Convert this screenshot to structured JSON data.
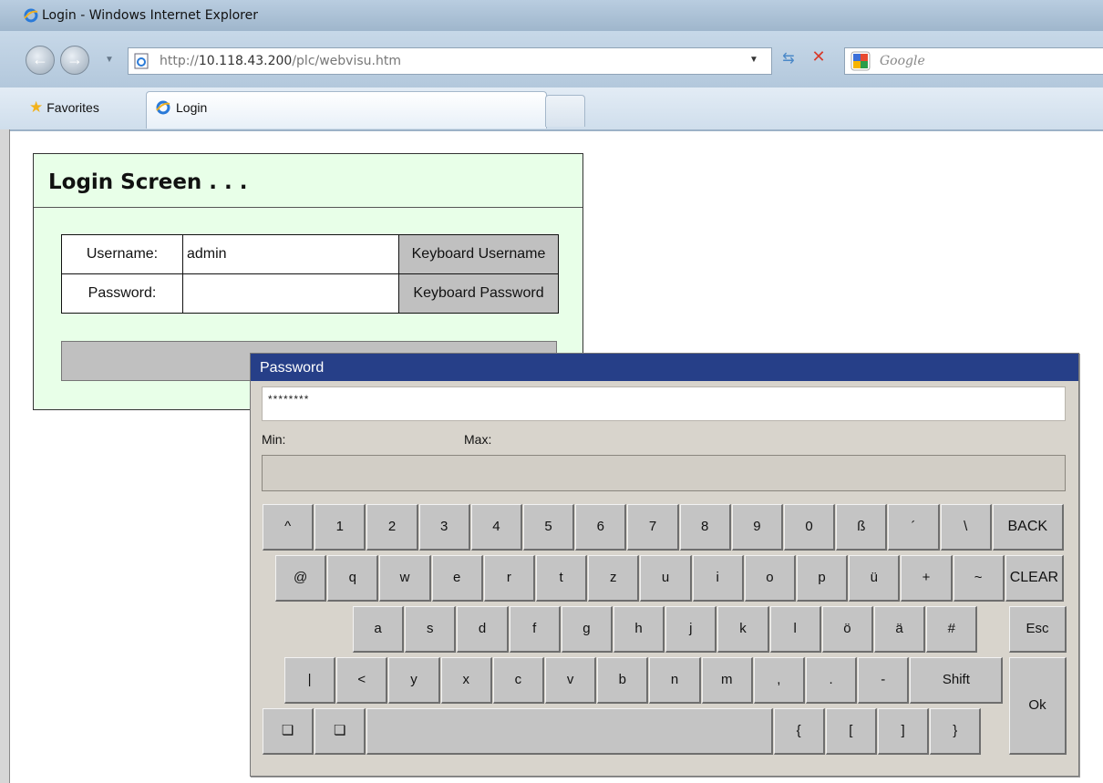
{
  "browser": {
    "window_title": "Login - Windows Internet Explorer",
    "url_prefix": "http://",
    "url_host": "10.118.43.200",
    "url_path": "/plc/webvisu.htm",
    "search_placeholder": "Google",
    "favorites_label": "Favorites",
    "tab_label": "Login"
  },
  "login": {
    "title": "Login Screen . . .",
    "username_label": "Username:",
    "username_value": "admin",
    "password_label": "Password:",
    "password_value": "",
    "keyboard_username_label": "Keyboard Username",
    "keyboard_password_label": "Keyboard Password"
  },
  "keyboard": {
    "title": "Password",
    "input_value": "********",
    "min_label": "Min:",
    "max_label": "Max:",
    "rows": [
      [
        "^",
        "1",
        "2",
        "3",
        "4",
        "5",
        "6",
        "7",
        "8",
        "9",
        "0",
        "ß",
        "´",
        "\\",
        "BACK"
      ],
      [
        "@",
        "q",
        "w",
        "e",
        "r",
        "t",
        "z",
        "u",
        "i",
        "o",
        "p",
        "ü",
        "+",
        "~",
        "CLEAR"
      ],
      [
        "a",
        "s",
        "d",
        "f",
        "g",
        "h",
        "j",
        "k",
        "l",
        "ö",
        "ä",
        "#",
        "Esc"
      ],
      [
        "|",
        "<",
        "y",
        "x",
        "c",
        "v",
        "b",
        "n",
        "m",
        ",",
        ".",
        "-",
        "Shift",
        "Ok"
      ],
      [
        "❏",
        "❏",
        "",
        "{",
        "[",
        "]",
        "}"
      ]
    ]
  }
}
